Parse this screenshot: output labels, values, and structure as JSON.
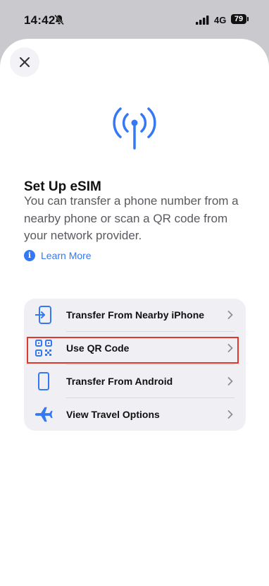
{
  "status_bar": {
    "time": "14:42",
    "network": "4G",
    "battery": "79"
  },
  "sheet": {
    "close_icon": "close-icon",
    "hero_icon": "antenna-signal-icon",
    "title": "Set Up eSIM",
    "description": "You can transfer a phone number from a nearby phone or scan a QR code from your network provider.",
    "learn_more": "Learn More"
  },
  "options": [
    {
      "label": "Transfer From Nearby iPhone",
      "icon": "transfer-phone-icon"
    },
    {
      "label": "Use QR Code",
      "icon": "qr-code-icon"
    },
    {
      "label": "Transfer From Android",
      "icon": "android-phone-icon"
    },
    {
      "label": "View Travel Options",
      "icon": "airplane-icon"
    }
  ],
  "colors": {
    "accent": "#3478f6",
    "highlight": "#e0392b",
    "group_bg": "#efeff4"
  }
}
